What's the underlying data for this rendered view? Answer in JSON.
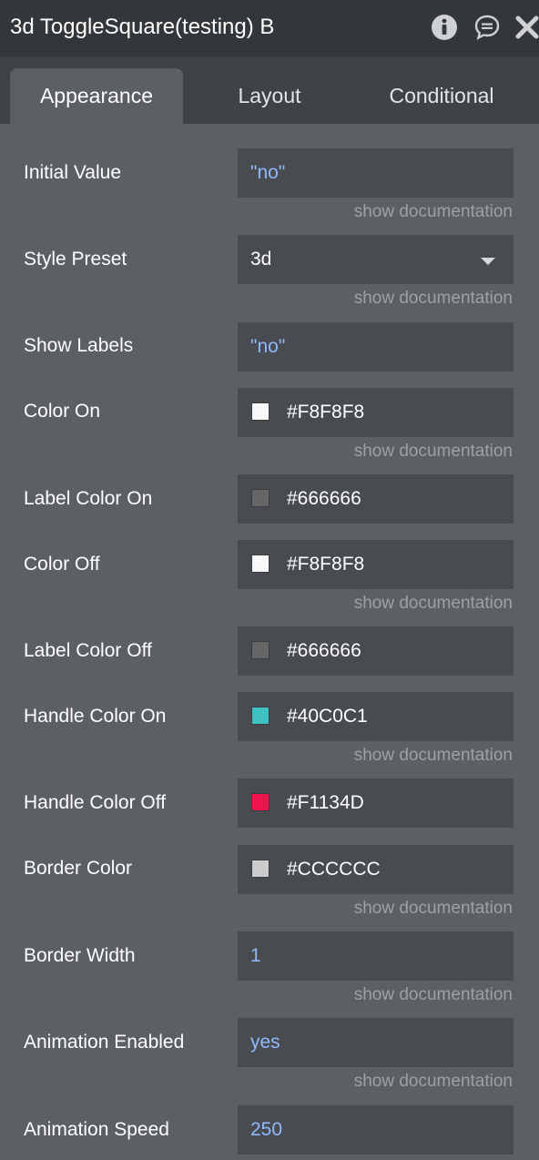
{
  "header": {
    "title": "3d ToggleSquare(testing) B",
    "icons": [
      "info-icon",
      "comment-icon",
      "close-icon"
    ]
  },
  "tabs": [
    {
      "label": "Appearance",
      "active": true
    },
    {
      "label": "Layout",
      "active": false
    },
    {
      "label": "Conditional",
      "active": false
    }
  ],
  "doc_link": "show documentation",
  "fields": {
    "initial_value": {
      "label": "Initial Value",
      "value": "\"no\""
    },
    "style_preset": {
      "label": "Style Preset",
      "value": "3d"
    },
    "show_labels": {
      "label": "Show Labels",
      "value": "\"no\""
    },
    "color_on": {
      "label": "Color On",
      "value": "#F8F8F8",
      "swatch": "#F8F8F8"
    },
    "label_color_on": {
      "label": "Label Color On",
      "value": "#666666",
      "swatch": "#666666"
    },
    "color_off": {
      "label": "Color Off",
      "value": "#F8F8F8",
      "swatch": "#F8F8F8"
    },
    "label_color_off": {
      "label": "Label Color Off",
      "value": "#666666",
      "swatch": "#666666"
    },
    "handle_color_on": {
      "label": "Handle Color On",
      "value": "#40C0C1",
      "swatch": "#40C0C1"
    },
    "handle_color_off": {
      "label": "Handle Color Off",
      "value": "#F1134D",
      "swatch": "#F1134D"
    },
    "border_color": {
      "label": "Border Color",
      "value": "#CCCCCC",
      "swatch": "#CCCCCC"
    },
    "border_width": {
      "label": "Border Width",
      "value": "1"
    },
    "animation_enabled": {
      "label": "Animation Enabled",
      "value": "yes"
    },
    "animation_speed": {
      "label": "Animation Speed",
      "value": "250"
    }
  }
}
